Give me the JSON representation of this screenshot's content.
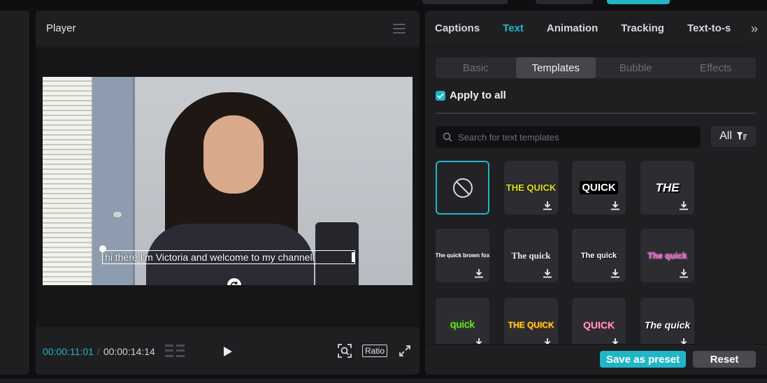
{
  "colors": {
    "accent": "#21b6c6",
    "panel": "#1f1f22",
    "background": "#0f0f11"
  },
  "player": {
    "title": "Player",
    "caption": "hi there I'm Victoria and welcome to my channell",
    "time_current": "00:00:11:01",
    "time_separator": "/",
    "time_total": "00:00:14:14",
    "ratio_label": "Ratio"
  },
  "right_panel": {
    "tabs": [
      "Captions",
      "Text",
      "Animation",
      "Tracking",
      "Text-to-s"
    ],
    "active_tab": "Text",
    "subtabs": [
      "Basic",
      "Templates",
      "Bubble",
      "Effects"
    ],
    "active_subtab": "Templates",
    "apply_to_all": {
      "label": "Apply to all",
      "checked": true
    },
    "search_placeholder": "Search for text templates",
    "filter_label": "All",
    "templates": [
      {
        "label": "",
        "icon": "none-icon",
        "selected": true
      },
      {
        "label": "THE QUICK",
        "color": "#e8e21a"
      },
      {
        "label": "QUICK",
        "color": "#ffffff"
      },
      {
        "label": "THE",
        "color": "#ffffff"
      },
      {
        "label": "The quick brown fox",
        "color": "#ffffff"
      },
      {
        "label": "The quick",
        "color": "#e8e8e8"
      },
      {
        "label": "The quick",
        "color": "#ffffff"
      },
      {
        "label": "The quick",
        "color": "#ff4fd8"
      },
      {
        "label": "quick",
        "color": "#7dff2e"
      },
      {
        "label": "THE QUICK",
        "color": "#ffd21a"
      },
      {
        "label": "QUICK",
        "color": "#ff9ac8"
      },
      {
        "label": "The quick",
        "color": "#ffffff"
      }
    ],
    "save_preset_label": "Save as preset",
    "reset_label": "Reset"
  }
}
